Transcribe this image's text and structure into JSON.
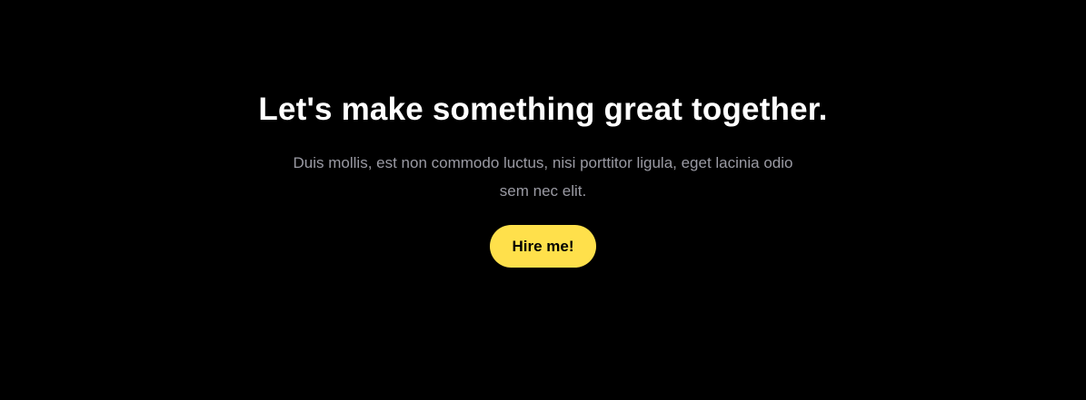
{
  "cta": {
    "title": "Let's make something great together.",
    "description": "Duis mollis, est non commodo luctus, nisi porttitor ligula, eget lacinia odio sem nec elit.",
    "button_label": "Hire me!"
  },
  "colors": {
    "accent": "#ffe04b",
    "background": "#000000",
    "text_muted": "#9a9aa3"
  }
}
